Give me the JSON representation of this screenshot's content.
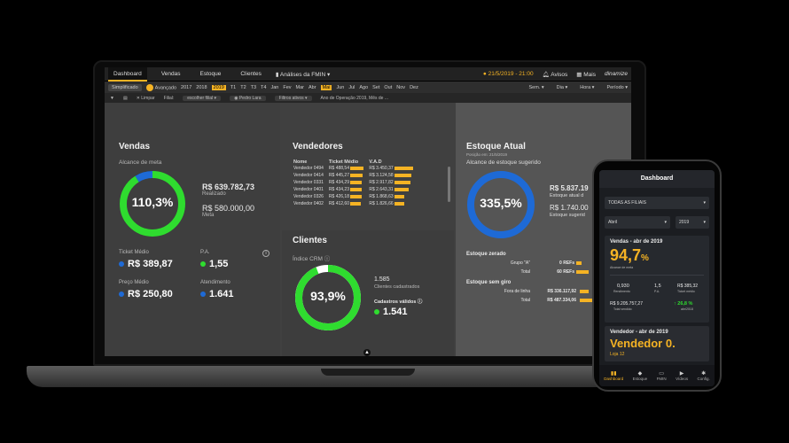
{
  "topbar": {
    "tabs": [
      "Dashboard",
      "Vendas",
      "Estoque",
      "Clientes"
    ],
    "analysis": "Análises da FMIN",
    "datetime": "21/5/2019 - 21:00",
    "avisos": "Avisos",
    "mais": "Mais",
    "brand": "dinamize"
  },
  "filters": {
    "simplificado": "Simplificado",
    "avancado": "Avançado",
    "years": [
      "2017",
      "2018",
      "2019"
    ],
    "trimestres": [
      "T1",
      "T2",
      "T3",
      "T4"
    ],
    "months": [
      "Jan",
      "Fev",
      "Mar",
      "Abr",
      "Mai",
      "Jun",
      "Jul",
      "Ago",
      "Set",
      "Out",
      "Nov",
      "Dez"
    ],
    "semana": "Sem.",
    "dia": "Dia",
    "hora": "Hora",
    "periodo": "Período",
    "limpar": "Limpar",
    "filial_label": "Filial:",
    "filial_value": "escolher filial",
    "vendedor_value": "Pedro Lara",
    "filtros_ativos": "Filtros ativos",
    "filtros_text": "Ano de Operação 2019, Mês de ..."
  },
  "vendas": {
    "title": "Vendas",
    "subtitle": "Alcance de meta",
    "ring_value": "110,3%",
    "realizado_value": "R$ 639.782,73",
    "realizado_label": "Realizado",
    "meta_value": "R$ 580.000,00",
    "meta_label": "Meta",
    "ticket_label": "Ticket Médio",
    "ticket_value": "R$ 389,87",
    "pa_label": "P.A.",
    "pa_value": "1,55",
    "preco_label": "Preço Médio",
    "preco_value": "R$ 250,80",
    "atendimento_label": "Atendimento",
    "atendimento_value": "1.641",
    "ring_progress": 1.103
  },
  "vendedores": {
    "title": "Vendedores",
    "headers": [
      "Nome",
      "Ticket Médio",
      "V.A.D"
    ],
    "rows": [
      {
        "nome": "Vendedor 0494",
        "ticket": "R$ 488,54",
        "vad": "R$ 3.450,37",
        "tbar": 0.95,
        "vbar": 0.95
      },
      {
        "nome": "Vendedor 0414",
        "ticket": "R$ 445,27",
        "vad": "R$ 3.124,58",
        "tbar": 0.85,
        "vbar": 0.86
      },
      {
        "nome": "Vendedor 0331",
        "ticket": "R$ 434,29",
        "vad": "R$ 2.917,82",
        "tbar": 0.82,
        "vbar": 0.8
      },
      {
        "nome": "Vendedor 0401",
        "ticket": "R$ 434,23",
        "vad": "R$ 2.643,31",
        "tbar": 0.82,
        "vbar": 0.72
      },
      {
        "nome": "Vendedor 0326",
        "ticket": "R$ 426,18",
        "vad": "R$ 1.868,63",
        "tbar": 0.8,
        "vbar": 0.52
      },
      {
        "nome": "Vendedor 0402",
        "ticket": "R$ 412,60",
        "vad": "R$ 1.826,66",
        "tbar": 0.76,
        "vbar": 0.5
      }
    ]
  },
  "clientes": {
    "title": "Clientes",
    "subtitle": "Índice CRM",
    "ring_value": "93,9%",
    "cadastrados_value": "1.585",
    "cadastrados_label": "Clientes cadastrados",
    "validos_label": "Cadastros válidos",
    "validos_value": "1.541",
    "ring_progress": 0.939
  },
  "estoque": {
    "title": "Estoque Atual",
    "posicao": "Posição em: 21/5/2019",
    "subtitle": "Alcance de estoque sugerido",
    "ring_value": "335,5%",
    "atual_value": "R$ 5.837.19",
    "atual_label": "Estoque atual d",
    "sugerido_value": "R$ 1.740.00",
    "sugerido_label": "Estoque sugerid",
    "zerado_title": "Estoque zerado",
    "zerado_grupo": "Grupo \"A\"",
    "zerado_grupo_val": "0 REFs",
    "zerado_total": "Total",
    "zerado_total_val": "60 REFs",
    "semgiro_title": "Estoque sem giro",
    "fora_label": "Fora de linha",
    "fora_val": "R$ 336.117,92",
    "semgiro_total": "Total",
    "semgiro_total_val": "R$ 487.334,06",
    "ring_progress": 1.0
  },
  "phone": {
    "title": "Dashboard",
    "filial": "TODAS AS FILIAIS",
    "mes": "Abril",
    "ano": "2019",
    "vendas_title": "Vendas - abr de 2019",
    "vendas_value": "94,7",
    "vendas_unit": "%",
    "alcance_label": "Alcance de meta",
    "kpi1_val": "0,930",
    "kpi1_lab": "Rendimento",
    "kpi2_val": "1,5",
    "kpi2_lab": "P.A.",
    "kpi3_val": "R$ 385,32",
    "kpi3_lab": "Ticket médio",
    "total_val": "R$ 9.205.757,27",
    "total_lab": "Total vendido",
    "var_val": "↑ 26,8 %",
    "var_lab": "abr/2018",
    "vendedor_title": "Vendedor - abr de 2019",
    "vendedor_name": "Vendedor 0.",
    "loja": "Loja 12",
    "nav": [
      "Dashboard",
      "Estoque",
      "FMIN",
      "Vídeos",
      "Config."
    ]
  },
  "colors": {
    "accent": "#f5b324",
    "green": "#2fdc2f",
    "blue": "#1e6ad6"
  }
}
